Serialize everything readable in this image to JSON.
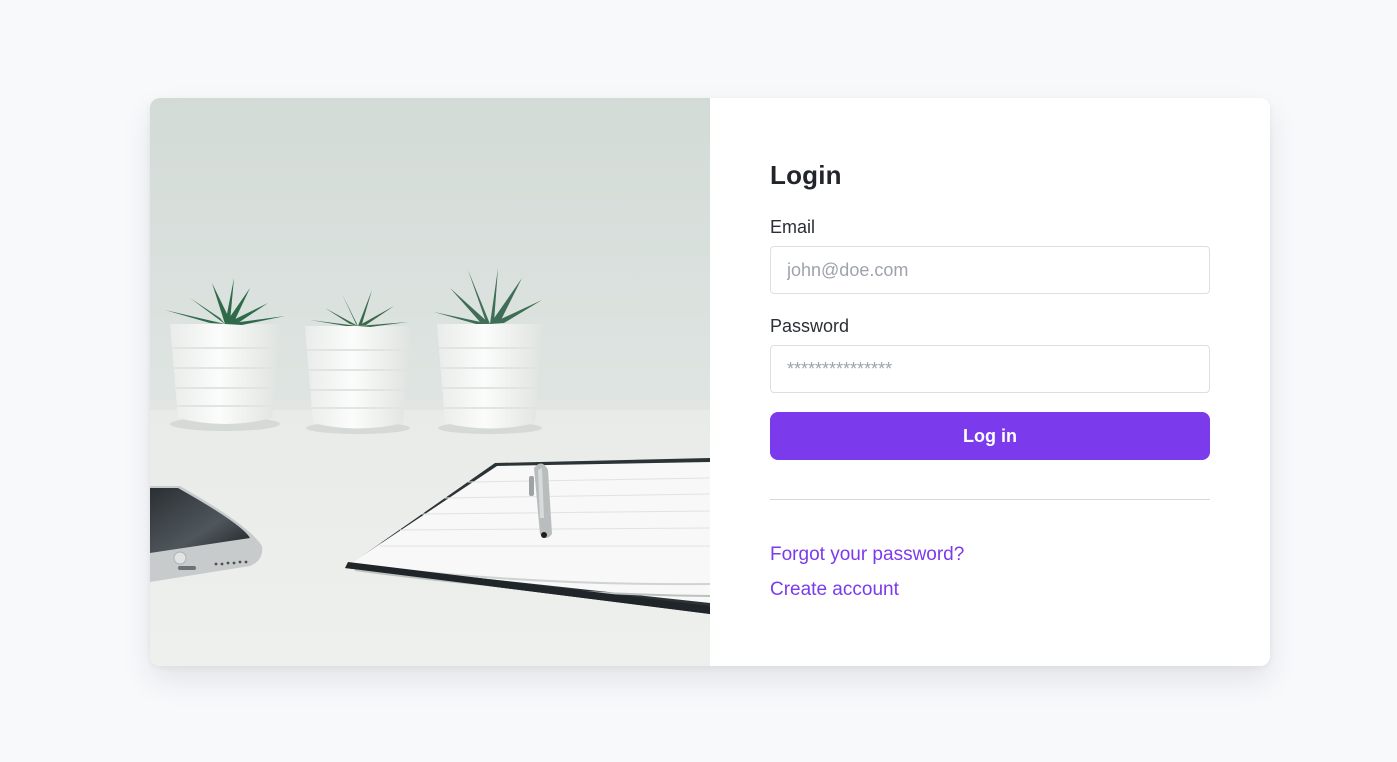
{
  "login": {
    "title": "Login",
    "email_label": "Email",
    "email_placeholder": "john@doe.com",
    "password_label": "Password",
    "password_placeholder": "***************",
    "submit_label": "Log in",
    "forgot_link": "Forgot your password?",
    "create_link": "Create account"
  },
  "colors": {
    "accent": "#7c3aed",
    "page_background": "#f8f9fb",
    "card_background": "#ffffff"
  }
}
